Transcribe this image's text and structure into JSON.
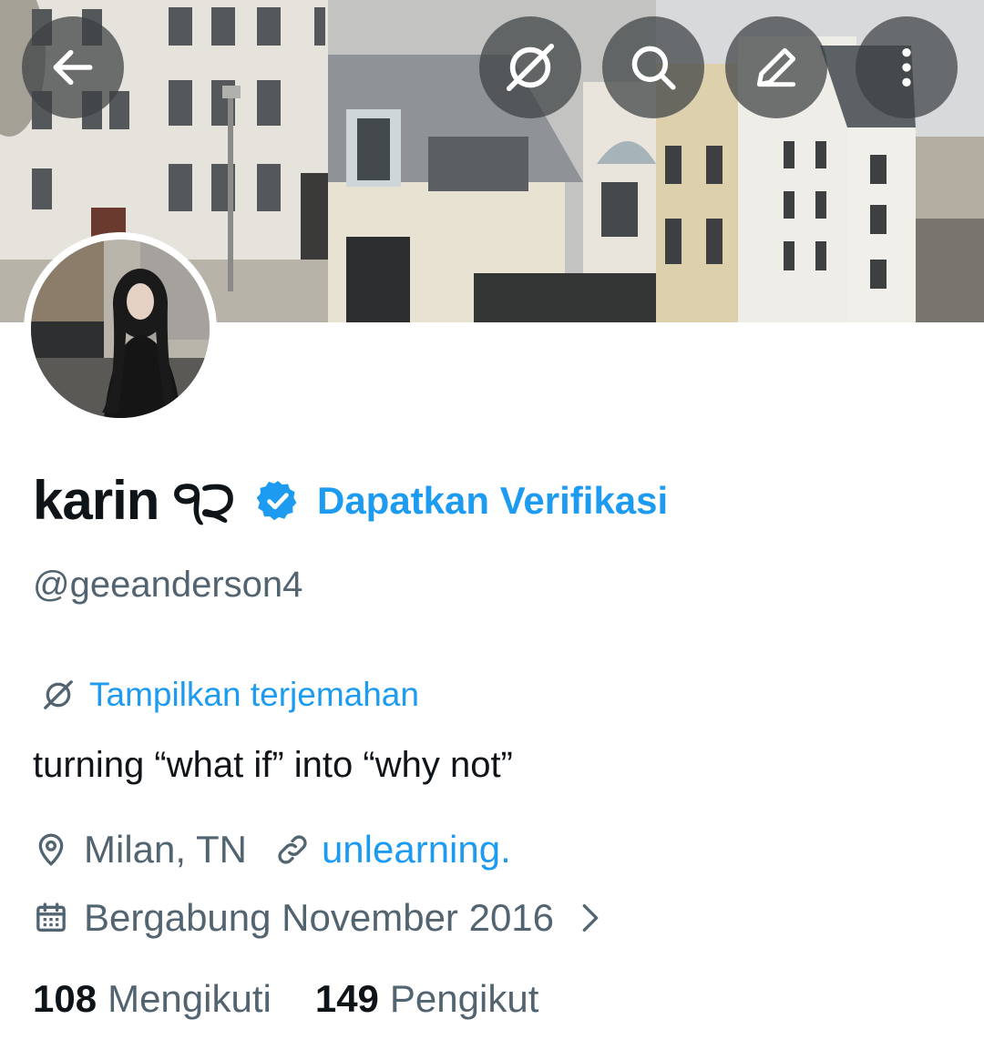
{
  "header": {
    "back_icon": "arrow-left-icon",
    "translate_icon": "translate-slash-icon",
    "search_icon": "search-icon",
    "edit_icon": "pencil-icon",
    "more_icon": "more-vertical-icon"
  },
  "profile": {
    "display_name": "karin ੧੨",
    "verify_link": "Dapatkan Verifikasi",
    "handle": "@geeanderson4",
    "translate_label": "Tampilkan terjemahan",
    "bio": "turning “what if” into “why not”",
    "location": "Milan, TN",
    "website": "unlearning.",
    "joined": "Bergabung November 2016",
    "following_count": "108",
    "following_label": "Mengikuti",
    "followers_count": "149",
    "followers_label": "Pengikut"
  },
  "colors": {
    "accent": "#1d9bf0",
    "text_primary": "#0f1419",
    "text_secondary": "#536471"
  }
}
